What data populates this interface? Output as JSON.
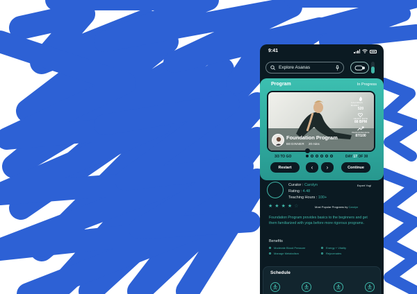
{
  "colors": {
    "scribble": "#2d61d5",
    "phone_bg": "#0b1a22",
    "accent": "#3fb6a8"
  },
  "status_bar": {
    "time": "9:41"
  },
  "search": {
    "placeholder": "Explore Asanas"
  },
  "program": {
    "header": "Program",
    "status": "In Progress",
    "title": "Foundation Program",
    "level": "BEGINNER",
    "duration": "20 mins",
    "stats": [
      {
        "label": "CALORIES BURNT",
        "value": "520",
        "icon": "flame-icon"
      },
      {
        "label": "HEART RATE",
        "value": "88 BPM",
        "icon": "heart-icon"
      },
      {
        "label": "PERFORMANCE",
        "value": "87/100",
        "icon": "trend-icon"
      }
    ],
    "to_go": "3/3 TO GO",
    "day_prefix": "DAY",
    "day_current": "17",
    "day_total_text": "OF 30",
    "progress_dots": {
      "total": 6,
      "active": 1
    },
    "buttons": {
      "restart": "Restart",
      "prev": "‹",
      "next": "›",
      "continue": "Continue"
    }
  },
  "curator": {
    "curator_label": "Curator : ",
    "curator_name": "Carolyn",
    "rating_label": "Rating : ",
    "rating_value": "4.48",
    "hours_label": "Teaching Hours : ",
    "hours_value": "100+",
    "badge": "Expert Yogi",
    "stars": {
      "filled": 4,
      "total": 5
    },
    "popular_label": "Most Popular Programs by ",
    "popular_name": "Carolyn",
    "description": "Foundation Program provides basics to the beginners and get them familiarized with yoga before more rigorous programs."
  },
  "benefits": {
    "heading": "Benefits",
    "items": [
      "Moderate Blood Pressure",
      "Energy + Vitality",
      "Manage Metabolism",
      "Rejuvenates"
    ]
  },
  "schedule": {
    "heading": "Schedule",
    "slots": 4
  }
}
